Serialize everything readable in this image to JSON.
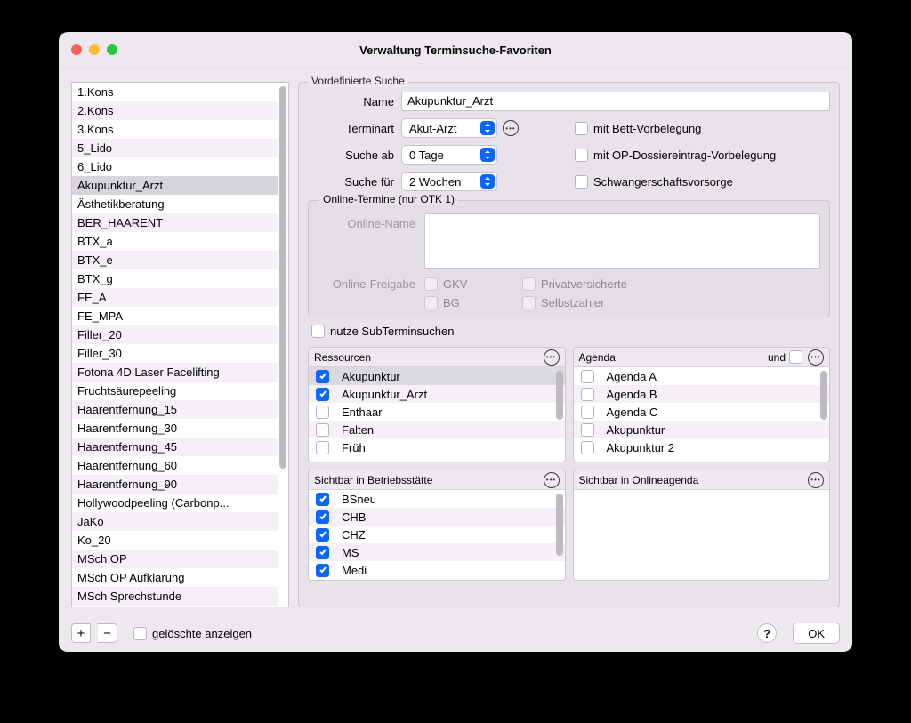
{
  "window": {
    "title": "Verwaltung Terminsuche-Favoriten"
  },
  "sidebar": {
    "items": [
      "1.Kons",
      "2.Kons",
      "3.Kons",
      "5_Lido",
      "6_Lido",
      "Akupunktur_Arzt",
      "Ästhetikberatung",
      "BER_HAARENT",
      "BTX_a",
      "BTX_e",
      "BTX_g",
      "FE_A",
      "FE_MPA",
      "Filler_20",
      "Filler_30",
      "Fotona 4D Laser Facelifting",
      "Fruchtsäurepeeling",
      "Haarentfernung_15",
      "Haarentfernung_30",
      "Haarentfernung_45",
      "Haarentfernung_60",
      "Haarentfernung_90",
      "Hollywoodpeeling (Carbonp...",
      "JaKo",
      "Ko_20",
      "MSch OP",
      "MSch OP Aufklärung",
      "MSch Sprechstunde"
    ],
    "selectedIndex": 5
  },
  "group": {
    "legend": "Vordefinierte Suche",
    "name_label": "Name",
    "name_value": "Akupunktur_Arzt",
    "terminart_label": "Terminart",
    "terminart_value": "Akut-Arzt",
    "sucheab_label": "Suche ab",
    "sucheab_value": "0 Tage",
    "suchefuer_label": "Suche für",
    "suchefuer_value": "2 Wochen",
    "opt_bett": "mit Bett-Vorbelegung",
    "opt_op": "mit OP-Dossiereintrag-Vorbelegung",
    "opt_schwanger": "Schwangerschaftsvorsorge"
  },
  "online": {
    "legend": "Online-Termine (nur OTK 1)",
    "name_label": "Online-Name",
    "freigabe_label": "Online-Freigabe",
    "chk_gkv": "GKV",
    "chk_bg": "BG",
    "chk_privat": "Privatversicherte",
    "chk_selbst": "Selbstzahler"
  },
  "nutze_sub": "nutze SubTerminsuchen",
  "panelRessourcen": {
    "title": "Ressourcen",
    "items": [
      {
        "label": "Akupunktur",
        "checked": true,
        "selected": true
      },
      {
        "label": "Akupunktur_Arzt",
        "checked": true
      },
      {
        "label": "Enthaar",
        "checked": false
      },
      {
        "label": "Falten",
        "checked": false
      },
      {
        "label": "Früh",
        "checked": false
      }
    ]
  },
  "panelAgenda": {
    "title": "Agenda",
    "and_label": "und",
    "items": [
      {
        "label": "Agenda A",
        "checked": false
      },
      {
        "label": "Agenda B",
        "checked": false
      },
      {
        "label": "Agenda C",
        "checked": false
      },
      {
        "label": "Akupunktur",
        "checked": false
      },
      {
        "label": "Akupunktur 2",
        "checked": false
      }
    ]
  },
  "panelBetrieb": {
    "title": "Sichtbar in Betriebsstätte",
    "items": [
      {
        "label": "BSneu",
        "checked": true
      },
      {
        "label": "CHB",
        "checked": true
      },
      {
        "label": "CHZ",
        "checked": true
      },
      {
        "label": "MS",
        "checked": true
      },
      {
        "label": "Medi",
        "checked": true
      }
    ]
  },
  "panelOnline": {
    "title": "Sichtbar in Onlineagenda",
    "items": []
  },
  "footer": {
    "deleted_label": "gelöschte anzeigen",
    "help": "?",
    "ok": "OK",
    "plus": "+",
    "minus": "−"
  }
}
